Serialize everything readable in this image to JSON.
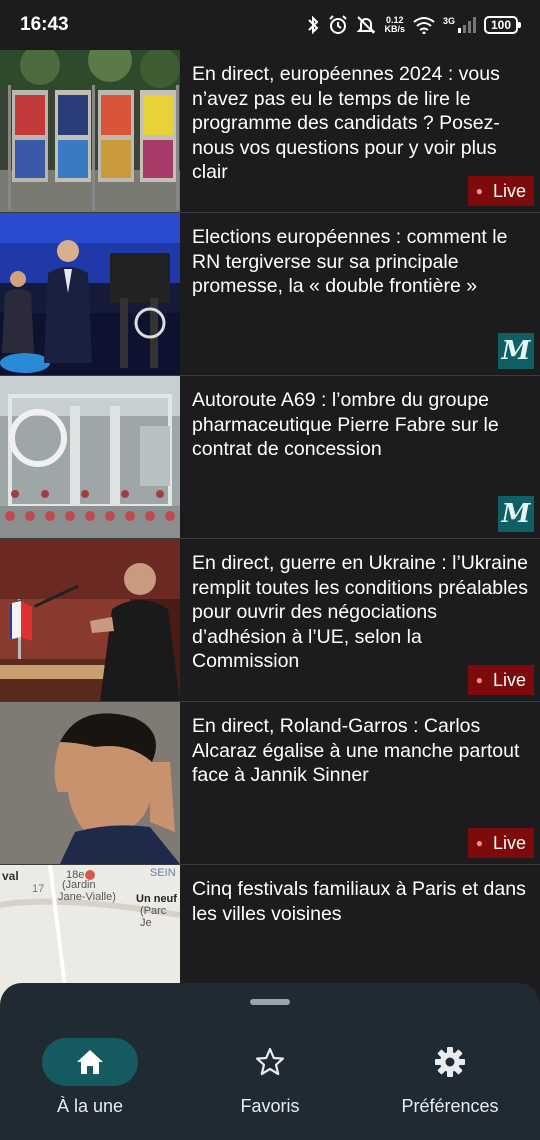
{
  "status_bar": {
    "time": "16:43",
    "net_speed_top": "0.12",
    "net_speed_bottom": "KB/s",
    "network": "3G",
    "battery": "100"
  },
  "articles": [
    {
      "headline": "En direct, européennes 2024 : vous n’avez pas eu le temps de lire le programme des candidats ? Posez-nous vos questions pour y voir plus clair",
      "badge": "live",
      "badge_label": "Live",
      "image": "election-posters-photo"
    },
    {
      "headline": "Elections européennes : comment le RN tergiverse sur sa principale promesse, la « double frontière »",
      "badge": "lemonde",
      "badge_label": "M",
      "image": "politician-tv-set-photo"
    },
    {
      "headline": "Autoroute A69 : l’ombre du groupe pharmaceutique Pierre Fabre sur le contrat de concession",
      "badge": "lemonde",
      "badge_label": "M",
      "image": "pharma-lab-photo"
    },
    {
      "headline": "En direct, guerre en Ukraine : l’Ukraine remplit toutes les conditions préalables pour ouvrir des négociations d’adhésion à l’UE, selon la Commission",
      "badge": "live",
      "badge_label": "Live",
      "image": "parliament-speech-photo"
    },
    {
      "headline": "En direct, Roland-Garros : Carlos Alcaraz égalise à une manche partout face à Jannik Sinner",
      "badge": "live",
      "badge_label": "Live",
      "image": "tennis-player-photo"
    },
    {
      "headline": "Cinq festivals familiaux à Paris et dans les villes voisines",
      "badge": "none",
      "badge_label": "",
      "image": "paris-map"
    }
  ],
  "map_labels": {
    "a": "val",
    "b": "18e",
    "c": "(Jardin",
    "d": "Jane-Vialle)",
    "e": "17",
    "f": "Un neuf",
    "g": "(Parc Je",
    "h": "SEIN"
  },
  "nav": {
    "home_label": "À la une",
    "favorites_label": "Favoris",
    "preferences_label": "Préférences"
  },
  "colors": {
    "background": "#1c1c1e",
    "live_badge": "#7d0b0b",
    "lemonde_badge": "#0f5f66",
    "nav_background": "#1f2a33",
    "nav_active_pill": "#155a61"
  }
}
